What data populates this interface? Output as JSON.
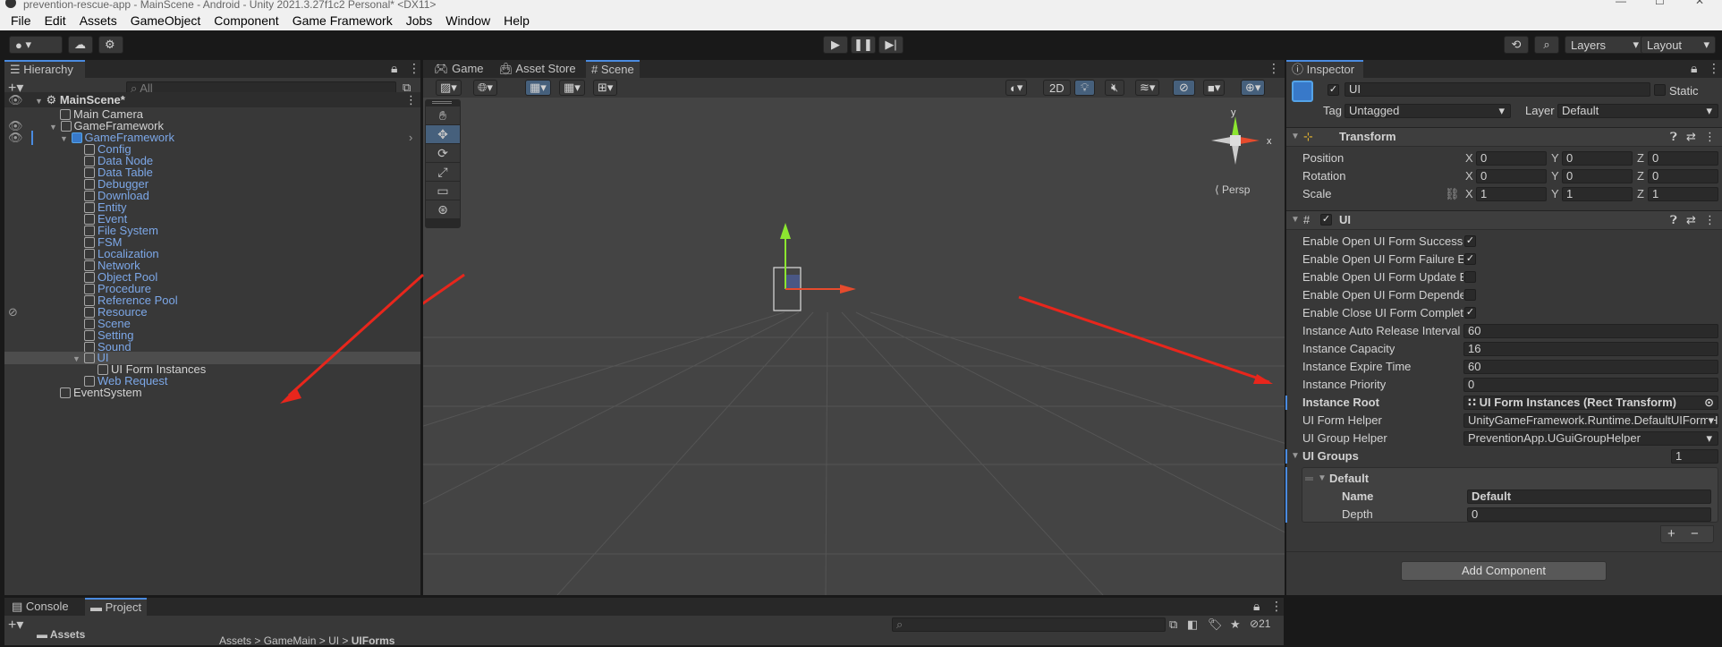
{
  "window": {
    "title": "prevention-rescue-app - MainScene - Android - Unity 2021.3.27f1c2 Personal* <DX11>"
  },
  "menu": [
    "File",
    "Edit",
    "Assets",
    "GameObject",
    "Component",
    "Game Framework",
    "Jobs",
    "Window",
    "Help"
  ],
  "toolbar": {
    "account": "▾",
    "layers": "Layers",
    "layout": "Layout"
  },
  "hierarchy": {
    "tab": "Hierarchy",
    "search_placeholder": "All",
    "scene": "MainScene*",
    "items": [
      {
        "label": "Main Camera"
      },
      {
        "label": "GameFramework"
      },
      {
        "label": "GameFramework"
      },
      {
        "label": "Config"
      },
      {
        "label": "Data Node"
      },
      {
        "label": "Data Table"
      },
      {
        "label": "Debugger"
      },
      {
        "label": "Download"
      },
      {
        "label": "Entity"
      },
      {
        "label": "Event"
      },
      {
        "label": "File System"
      },
      {
        "label": "FSM"
      },
      {
        "label": "Localization"
      },
      {
        "label": "Network"
      },
      {
        "label": "Object Pool"
      },
      {
        "label": "Procedure"
      },
      {
        "label": "Reference Pool"
      },
      {
        "label": "Resource"
      },
      {
        "label": "Scene"
      },
      {
        "label": "Setting"
      },
      {
        "label": "Sound"
      },
      {
        "label": "UI"
      },
      {
        "label": "UI Form Instances"
      },
      {
        "label": "Web Request"
      },
      {
        "label": "EventSystem"
      }
    ]
  },
  "scene_view": {
    "tabs": [
      "Game",
      "Asset Store",
      "Scene"
    ],
    "btn_2d": "2D",
    "persp": "Persp",
    "gizmo_x": "x",
    "gizmo_y": "y"
  },
  "inspector": {
    "tab": "Inspector",
    "object_name": "UI",
    "static_label": "Static",
    "tag_label": "Tag",
    "tag_value": "Untagged",
    "layer_label": "Layer",
    "layer_value": "Default",
    "transform": {
      "title": "Transform",
      "rows": [
        {
          "label": "Position",
          "x": "0",
          "y": "0",
          "z": "0"
        },
        {
          "label": "Rotation",
          "x": "0",
          "y": "0",
          "z": "0"
        },
        {
          "label": "Scale",
          "x": "1",
          "y": "1",
          "z": "1"
        }
      ],
      "axis_x": "X",
      "axis_y": "Y",
      "axis_z": "Z"
    },
    "ui_component": {
      "title": "UI",
      "toggles": [
        {
          "label": "Enable Open UI Form Success E",
          "checked": "✓"
        },
        {
          "label": "Enable Open UI Form Failure Eve",
          "checked": "✓"
        },
        {
          "label": "Enable Open UI Form Update Ev",
          "checked": ""
        },
        {
          "label": "Enable Open UI Form Dependen",
          "checked": ""
        },
        {
          "label": "Enable Close UI Form Complete",
          "checked": "✓"
        }
      ],
      "fields": [
        {
          "label": "Instance Auto Release Interval",
          "value": "60"
        },
        {
          "label": "Instance Capacity",
          "value": "16"
        },
        {
          "label": "Instance Expire Time",
          "value": "60"
        },
        {
          "label": "Instance Priority",
          "value": "0"
        }
      ],
      "instance_root_label": "Instance Root",
      "instance_root_value": "UI Form Instances (Rect Transform)",
      "form_helper_label": "UI Form Helper",
      "form_helper_value": "UnityGameFramework.Runtime.DefaultUIFormHelper",
      "group_helper_label": "UI Group Helper",
      "group_helper_value": "PreventionApp.UGuiGroupHelper",
      "groups_label": "UI Groups",
      "groups_count": "1",
      "group": {
        "title": "Default",
        "name_label": "Name",
        "name_value": "Default",
        "depth_label": "Depth",
        "depth_value": "0"
      },
      "plus": "+",
      "minus": "−"
    },
    "add_component": "Add Component"
  },
  "bottom": {
    "tabs": [
      "Console",
      "Project"
    ],
    "assets_label": "Assets",
    "breadcrumb": [
      "Assets",
      "GameMain",
      "UI",
      "UIForms"
    ],
    "count": "21"
  },
  "colors": {
    "accent": "#4a8be0",
    "blue_text": "#7ca7e7",
    "red_arrow": "#e8261c"
  }
}
